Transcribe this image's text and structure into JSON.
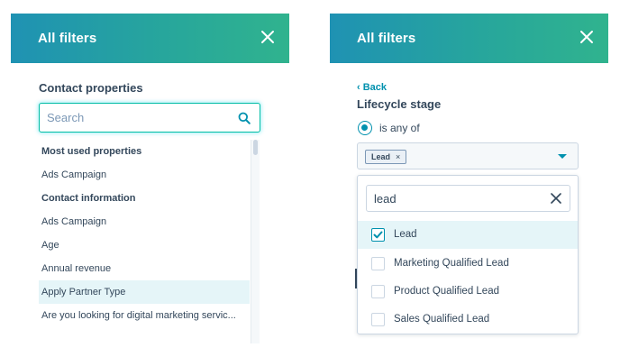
{
  "left_panel": {
    "title": "All filters",
    "section_title": "Contact properties",
    "search": {
      "placeholder": "Search",
      "value": ""
    },
    "properties": [
      {
        "label": "Most used properties",
        "kind": "header"
      },
      {
        "label": "Ads Campaign",
        "kind": "item"
      },
      {
        "label": "Contact information",
        "kind": "header"
      },
      {
        "label": "Ads Campaign",
        "kind": "item"
      },
      {
        "label": "Age",
        "kind": "item"
      },
      {
        "label": "Annual revenue",
        "kind": "item"
      },
      {
        "label": "Apply Partner Type",
        "kind": "item",
        "selected": true
      },
      {
        "label": "Are you looking for digital marketing servic...",
        "kind": "item"
      }
    ]
  },
  "right_panel": {
    "title": "All filters",
    "back_label": "Back",
    "field_title": "Lifecycle stage",
    "operator_label": "is any of",
    "selected_tags": [
      {
        "label": "Lead",
        "remove": "×"
      }
    ],
    "dropdown": {
      "search_value": "lead",
      "options": [
        {
          "label": "Lead",
          "checked": true
        },
        {
          "label": "Marketing Qualified Lead",
          "checked": false
        },
        {
          "label": "Product Qualified Lead",
          "checked": false
        },
        {
          "label": "Sales Qualified Lead",
          "checked": false
        }
      ]
    }
  },
  "icons": {
    "close": "close-icon",
    "search": "search-icon",
    "back": "chevron-left-icon",
    "caret": "caret-down-icon",
    "clear": "clear-icon",
    "check": "checkmark-icon"
  },
  "colors": {
    "header_gradient_start": "#1f92b3",
    "header_gradient_end": "#30b38e",
    "accent": "#0091ae",
    "search_focus": "#00bda5",
    "selected_row": "#e5f5f8",
    "text": "#33475b"
  }
}
